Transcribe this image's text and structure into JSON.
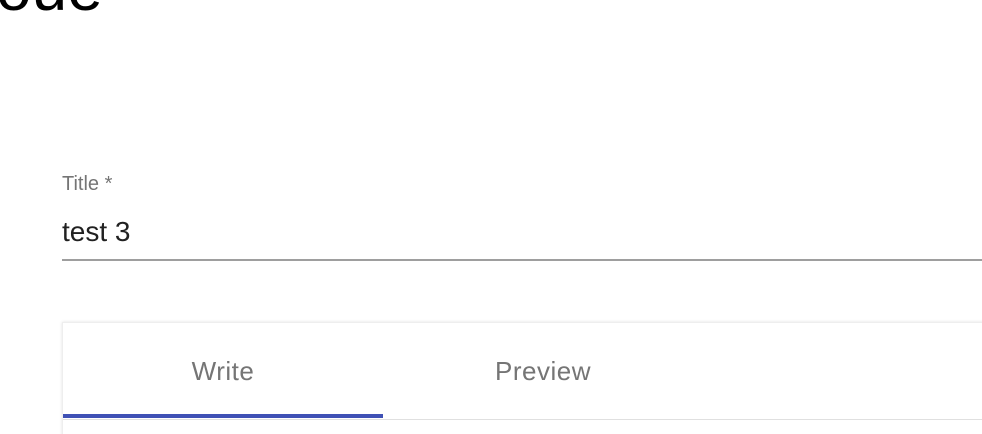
{
  "page": {
    "heading_fragment": "oue"
  },
  "form": {
    "title_label": "Title *",
    "title_value": "test 3"
  },
  "editor": {
    "tabs": [
      {
        "label": "Write",
        "selected": true
      },
      {
        "label": "Preview",
        "selected": false
      }
    ],
    "indicator_color": "#3f51b5"
  }
}
